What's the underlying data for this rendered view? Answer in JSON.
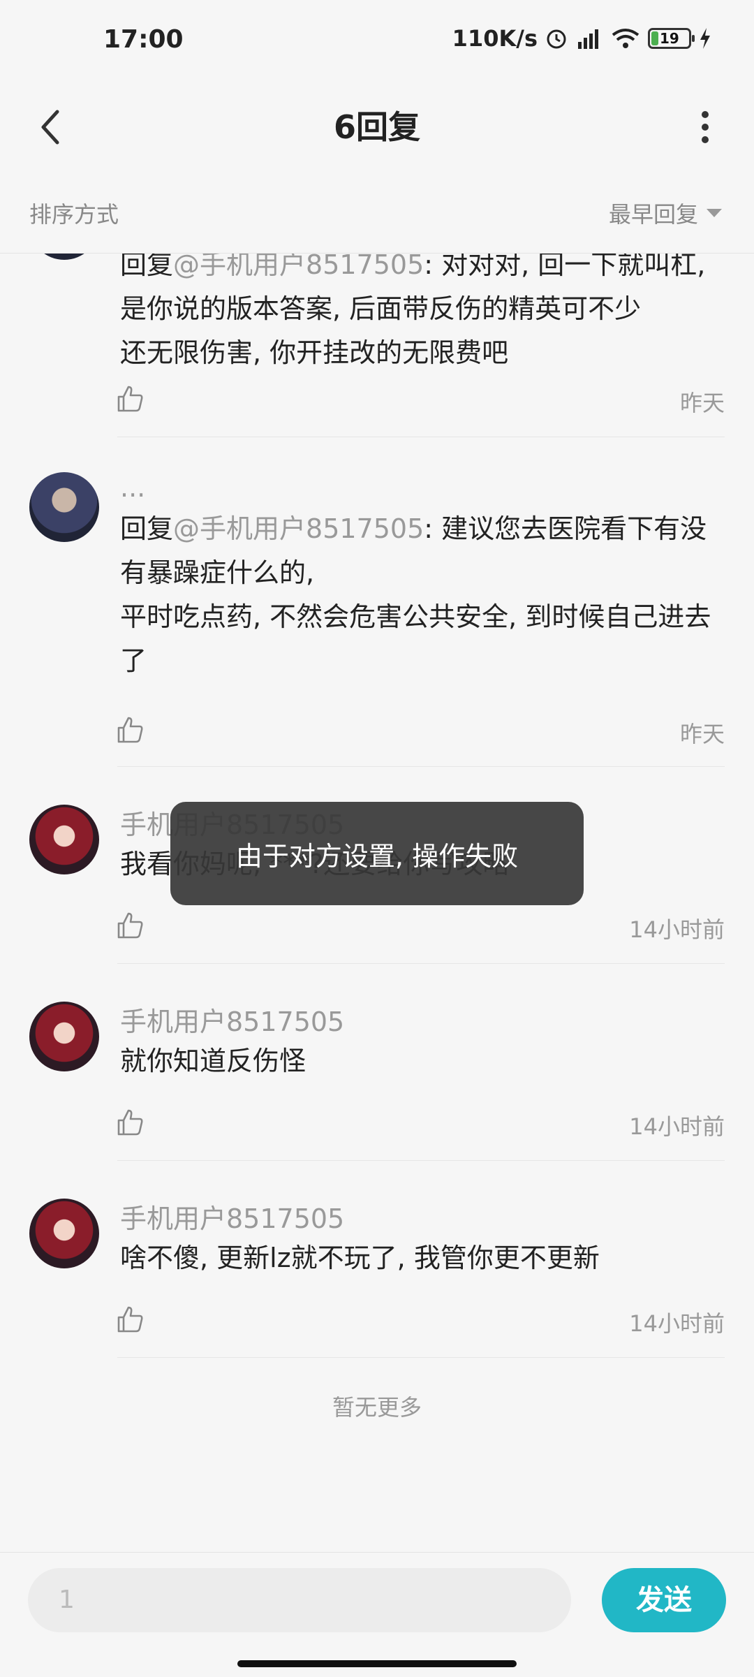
{
  "status_bar": {
    "time": "17:00",
    "network_speed": "110K/s",
    "battery": "19",
    "battery_level_percent": 19,
    "icons": [
      "alarm-icon",
      "signal-icon",
      "wifi-icon",
      "battery-icon",
      "charging-icon"
    ]
  },
  "header": {
    "title": "6回复",
    "icons": [
      "back-icon",
      "more-icon"
    ]
  },
  "sort": {
    "label": "排序方式",
    "value": "最早回复"
  },
  "replies": [
    {
      "user": "",
      "reply_prefix": "回复",
      "mention": "@手机用户8517505",
      "text": ": 对对对, 回一下就叫杠,",
      "lines": [
        "是你说的版本答案, 后面带反伤的精英可不少",
        "还无限伤害, 你开挂改的无限费吧"
      ],
      "time": "昨天"
    },
    {
      "user": "...",
      "reply_prefix": "回复",
      "mention": "@手机用户8517505",
      "text": ": 建议您去医院看下有没有暴躁症什么的,",
      "lines": [
        "平时吃点药, 不然会危害公共安全, 到时候自己进去了"
      ],
      "time": "昨天"
    },
    {
      "user": "手机用户8517505",
      "text": "我看你妈呢, ***?还要给你写攻略",
      "time": "14小时前"
    },
    {
      "user": "手机用户8517505",
      "text": "就你知道反伤怪",
      "time": "14小时前"
    },
    {
      "user": "手机用户8517505",
      "text": "啥不傻, 更新lz就不玩了, 我管你更不更新",
      "time": "14小时前"
    }
  ],
  "no_more": "暂无更多",
  "toast": "由于对方设置, 操作失败",
  "input": {
    "value": "1"
  },
  "send_label": "发送",
  "colors": {
    "accent": "#21b7c6",
    "background": "#f6f6f6",
    "secondary_text": "#999999"
  }
}
